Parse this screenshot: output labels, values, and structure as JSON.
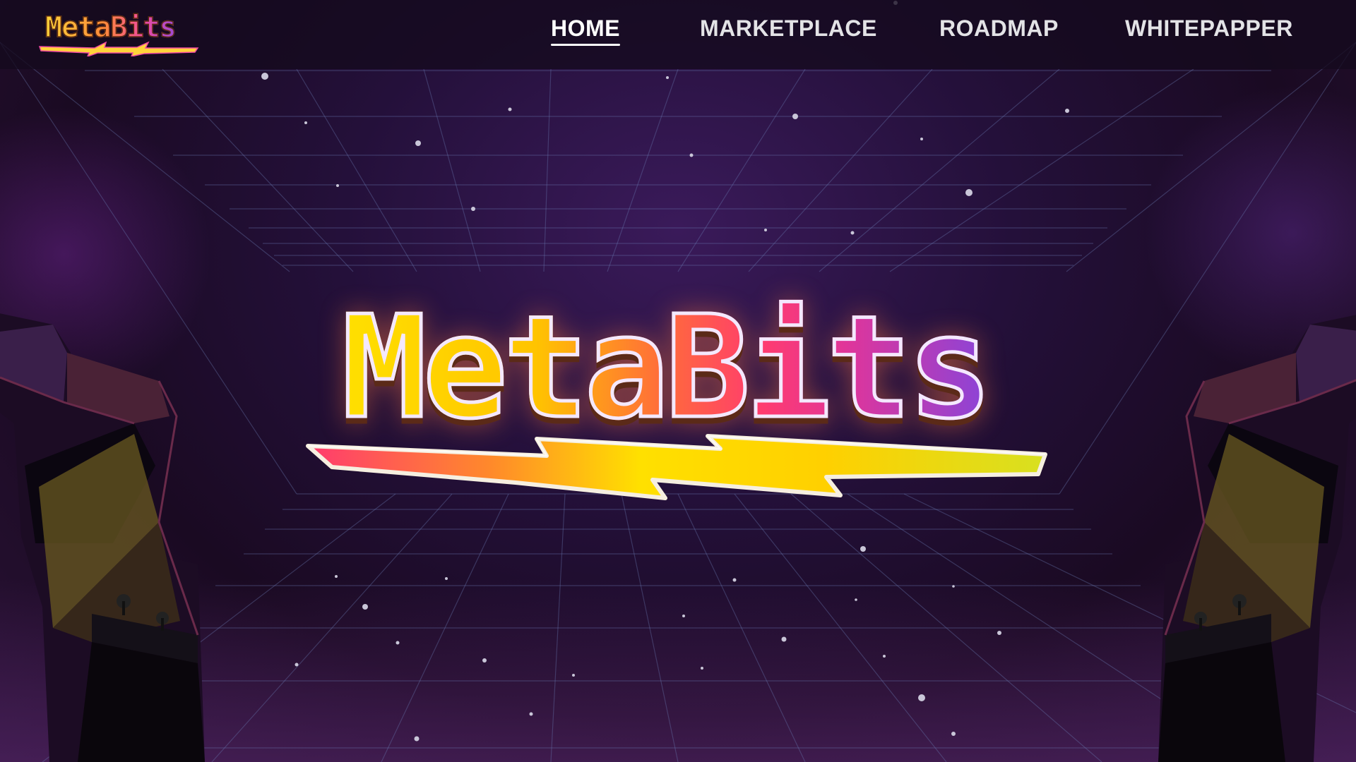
{
  "brand": {
    "logo_text": "MetaBits"
  },
  "nav": {
    "items": [
      {
        "label": "HOME",
        "active": true
      },
      {
        "label": "MARKETPLACE",
        "active": false
      },
      {
        "label": "ROADMAP",
        "active": false
      },
      {
        "label": "WHITEPAPPER",
        "active": false
      }
    ]
  },
  "hero": {
    "title": "MetaBits"
  },
  "theme": {
    "background": "#1a0b24",
    "nav_bar": "#140a1e",
    "grid_line": "#6a7ab0",
    "logo_yellow": "#ffe000",
    "logo_orange": "#ff6a3c",
    "logo_pink": "#e0359a",
    "logo_purple": "#8a44d8"
  },
  "icons": {
    "hero_bolt": "lightning-bolt-icon",
    "brand_bolt": "lightning-bolt-icon",
    "left_cabinet": "arcade-cabinet-icon",
    "right_cabinet": "arcade-cabinet-icon"
  }
}
